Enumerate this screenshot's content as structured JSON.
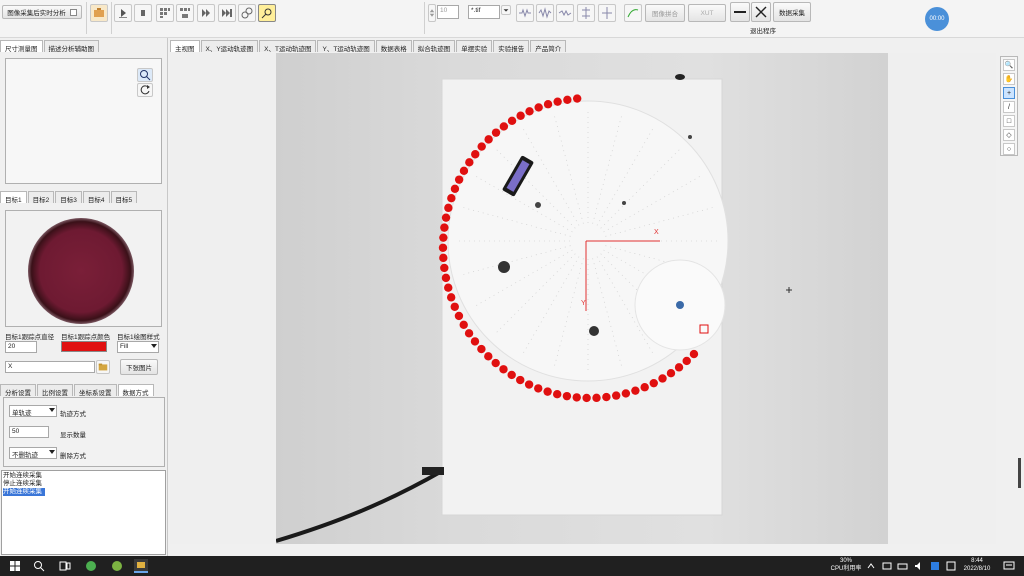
{
  "toolbar": {
    "main_button": "图像采集后实时分析",
    "frame_value": "10",
    "file_ext": "*.tif",
    "align_label": "图像拼合",
    "xut_label": "XUT",
    "pick_button": "数据采集",
    "exit_label": "退出程序",
    "timer_badge": "00:00"
  },
  "left": {
    "top_tabs": [
      "尺寸测量图",
      "描述分析辅助图"
    ],
    "target_tabs": [
      "目标1",
      "目标2",
      "目标3",
      "目标4",
      "目标5"
    ],
    "color_labels": {
      "size": "目标1跟踪点直径",
      "color": "目标1跟踪点颜色",
      "style": "目标1绘图样式"
    },
    "size_value": "20",
    "style_value": "Fill",
    "path_value": "X",
    "next_button": "下张图片",
    "setting_tabs": [
      "分析设置",
      "比例设置",
      "坐标系设置",
      "数据方式"
    ],
    "settings": [
      {
        "value": "单轨迹",
        "label": "轨迹方式"
      },
      {
        "value": "50",
        "label": "显示数量"
      },
      {
        "value": "不删轨迹",
        "label": "删除方式"
      }
    ],
    "log_lines": [
      "开始连续采集",
      "停止连续采集",
      "开始连续采集"
    ]
  },
  "view_tabs": [
    "主视图",
    "X、Y运动轨迹图",
    "X、T运动轨迹图",
    "Y、T运动轨迹图",
    "数据表格",
    "拟合轨迹图",
    "单摆实验",
    "实验报告",
    "产品简介"
  ],
  "overlay": {
    "x_axis_label": "X",
    "y_axis_label": "Y"
  },
  "taskbar": {
    "cpu_line1": "30%",
    "cpu_line2": "CPU利用率",
    "time": "8:44",
    "date": "2022/8/10"
  },
  "colors": {
    "trail": "#e01010",
    "axis": "#e03030",
    "accent": "#4a90d9"
  }
}
